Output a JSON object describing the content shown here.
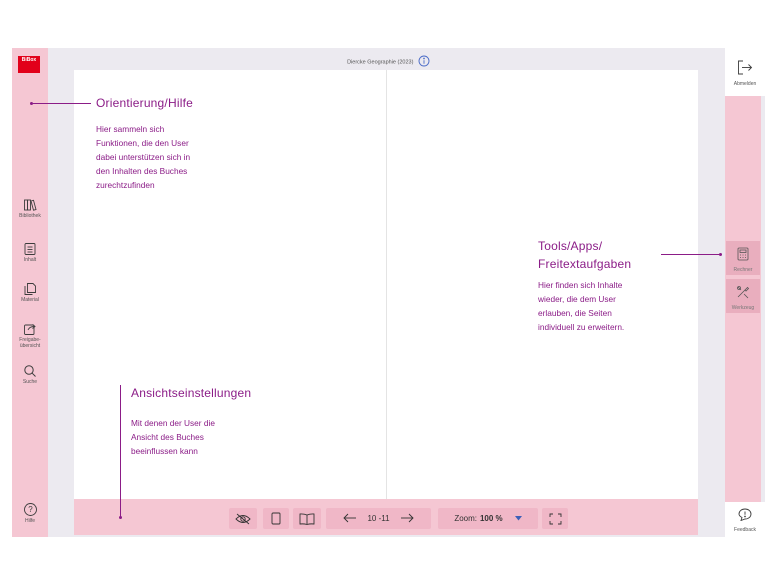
{
  "header": {
    "book_title": "Diercke Geographie (2023)"
  },
  "logo": {
    "text": "BiBox"
  },
  "left_nav": [
    {
      "label": "Bibliothek",
      "icon": "books-icon"
    },
    {
      "label": "Inhalt",
      "icon": "contents-icon"
    },
    {
      "label": "Material",
      "icon": "material-icon"
    },
    {
      "label": "Freigabe-\nübersicht",
      "icon": "share-icon"
    },
    {
      "label": "Suche",
      "icon": "search-icon"
    }
  ],
  "help": {
    "label": "Hilfe"
  },
  "logout": {
    "label": "Abmelden"
  },
  "right_tools": [
    {
      "label": "Rechner",
      "icon": "calculator-icon"
    },
    {
      "label": "Werkzeug",
      "icon": "tools-icon"
    }
  ],
  "feedback": {
    "label": "Feedback"
  },
  "toolbar": {
    "pages": "10 -11",
    "zoom_label": "Zoom:",
    "zoom_value": "100 %"
  },
  "annotations": {
    "orientation": {
      "title": "Orientierung/Hilfe",
      "lines": [
        "Hier sammeln sich",
        "Funktionen, die den User",
        "dabei unterstützen sich in",
        "den Inhalten des Buches",
        "zurechtzufinden"
      ]
    },
    "tools": {
      "title_lines": [
        "Tools/Apps/",
        "Freitextaufgaben"
      ],
      "lines": [
        "Hier finden sich Inhalte",
        "wieder, die dem User",
        "erlauben, die Seiten",
        "individuell zu erweitern."
      ]
    },
    "view": {
      "title": "Ansichtseinstellungen",
      "lines": [
        "Mit denen der User die",
        "Ansicht des Buches",
        "beeinflussen kann"
      ]
    }
  },
  "colors": {
    "sidebar": "#f5c7d3",
    "annotation": "#8b1c87",
    "logo": "#e2001a"
  }
}
